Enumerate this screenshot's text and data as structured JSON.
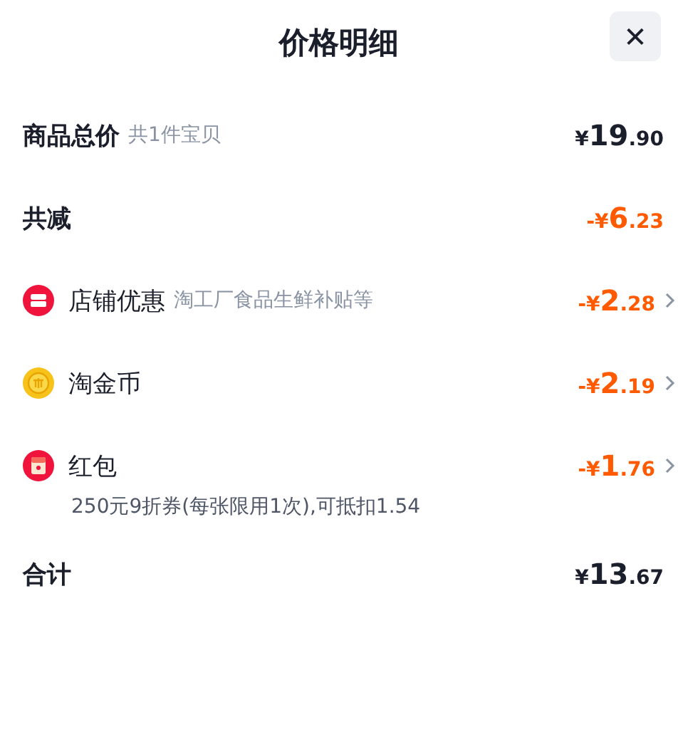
{
  "header": {
    "title": "价格明细",
    "close": "✕"
  },
  "rows": [
    {
      "kind": "summary",
      "label": "商品总价",
      "note": "共1件宝贝",
      "price": {
        "symbol": "¥",
        "integer": "19",
        "decimal": ".90"
      }
    },
    {
      "kind": "summary",
      "label": "共减",
      "price": {
        "sign": "-",
        "symbol": "¥",
        "integer": "6",
        "decimal": ".23"
      }
    },
    {
      "kind": "shop",
      "label": "店铺优惠",
      "note": "淘工厂食品生鲜补贴等",
      "price": {
        "sign": "-",
        "symbol": "¥",
        "integer": "2",
        "decimal": ".28"
      },
      "chevron": true
    },
    {
      "kind": "coin",
      "label": "淘金币",
      "price": {
        "sign": "-",
        "symbol": "¥",
        "integer": "2",
        "decimal": ".19"
      },
      "chevron": true
    },
    {
      "kind": "packet",
      "label": "红包",
      "detail": "250元9折券(每张限用1次),可抵扣1.54",
      "price": {
        "sign": "-",
        "symbol": "¥",
        "integer": "1",
        "decimal": ".76"
      },
      "chevron": true
    },
    {
      "kind": "summary",
      "label": "合计",
      "price": {
        "symbol": "¥",
        "integer": "13",
        "decimal": ".67"
      }
    }
  ]
}
